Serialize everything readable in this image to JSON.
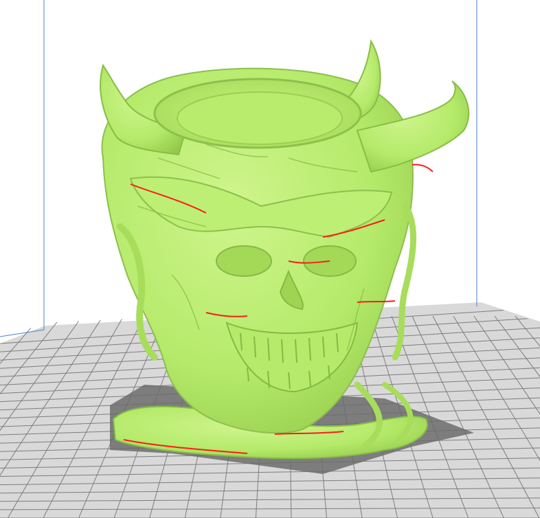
{
  "viewport": {
    "background": "#ffffff",
    "bed_color": "#d8d8d8",
    "grid_color": "#7f7f7f",
    "volume_line_color": "#4a7fd0",
    "model_color": "#b5ea6a",
    "model_shade_color": "#8fc447",
    "overhang_color": "#ff1a1a",
    "shadow_color": "#6e6e6e"
  },
  "model": {
    "icon": "demon-skull-planter-model"
  }
}
